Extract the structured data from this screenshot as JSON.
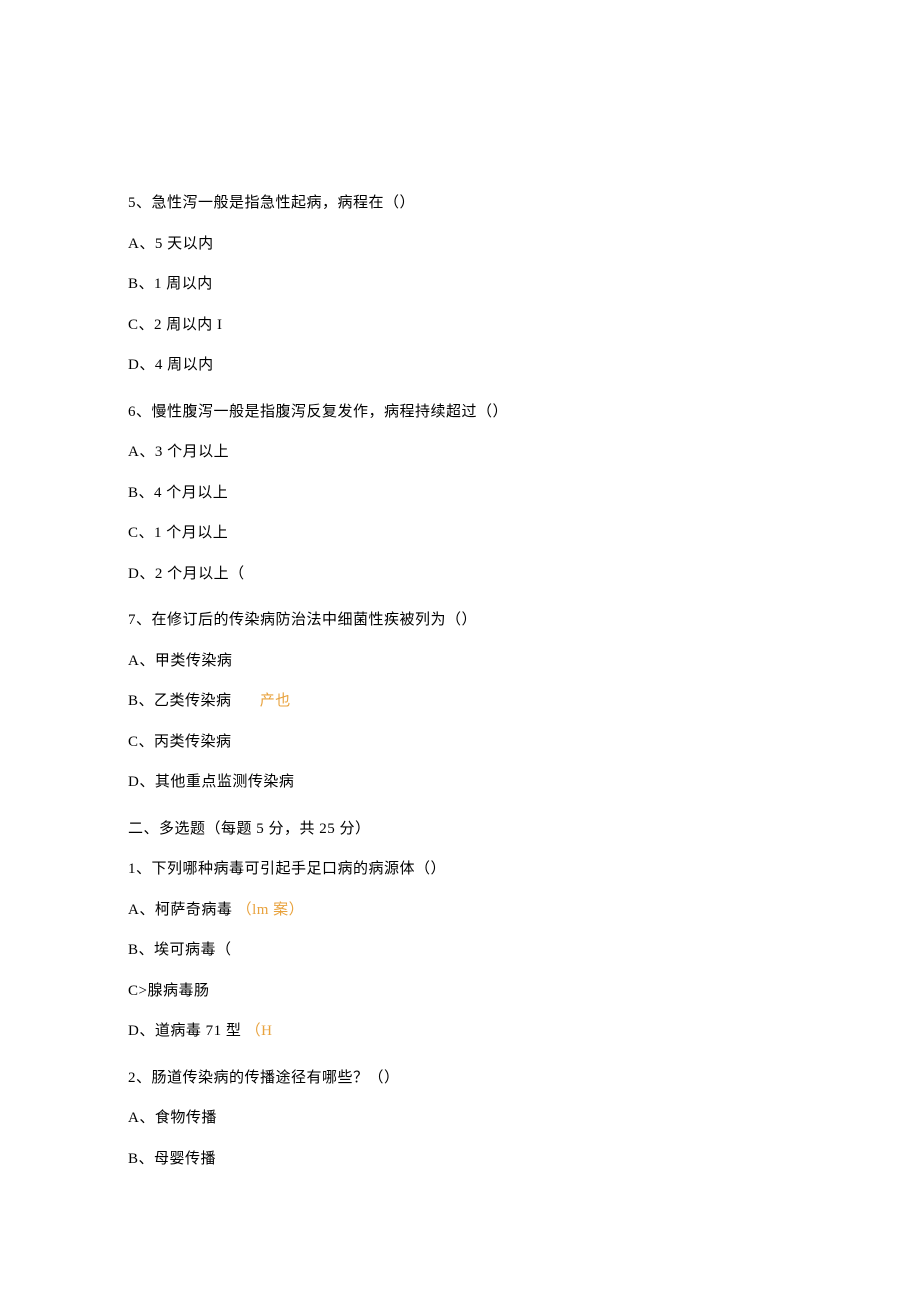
{
  "q5": {
    "text": "5、急性泻一般是指急性起病，病程在（）",
    "a": "A、5 天以内",
    "b": "B、1 周以内",
    "c": "C、2 周以内 I",
    "d": "D、4 周以内"
  },
  "q6": {
    "text": "6、慢性腹泻一般是指腹泻反复发作，病程持续超过（）",
    "a": "A、3 个月以上",
    "b": "B、4 个月以上",
    "c": "C、1 个月以上",
    "d": "D、2 个月以上（"
  },
  "q7": {
    "text": "7、在修订后的传染病防治法中细菌性疾被列为（）",
    "a": "A、甲类传染病",
    "b": "B、乙类传染病",
    "b_annotation": "产也",
    "c": "C、丙类传染病",
    "d": "D、其他重点监测传染病"
  },
  "section2": {
    "header": "二、多选题（每题 5 分，共 25 分）"
  },
  "m1": {
    "text": "1、下列哪种病毒可引起手足口病的病源体（）",
    "a_prefix": "A、柯萨奇病毒",
    "a_annotation": "（lm 案）",
    "b": "B、埃可病毒（",
    "c": "C>腺病毒肠",
    "d_prefix": "D、道病毒 71 型",
    "d_annotation": "（H"
  },
  "m2": {
    "text": "2、肠道传染病的传播途径有哪些？（）",
    "a": "A、食物传播",
    "b": "B、母婴传播"
  }
}
